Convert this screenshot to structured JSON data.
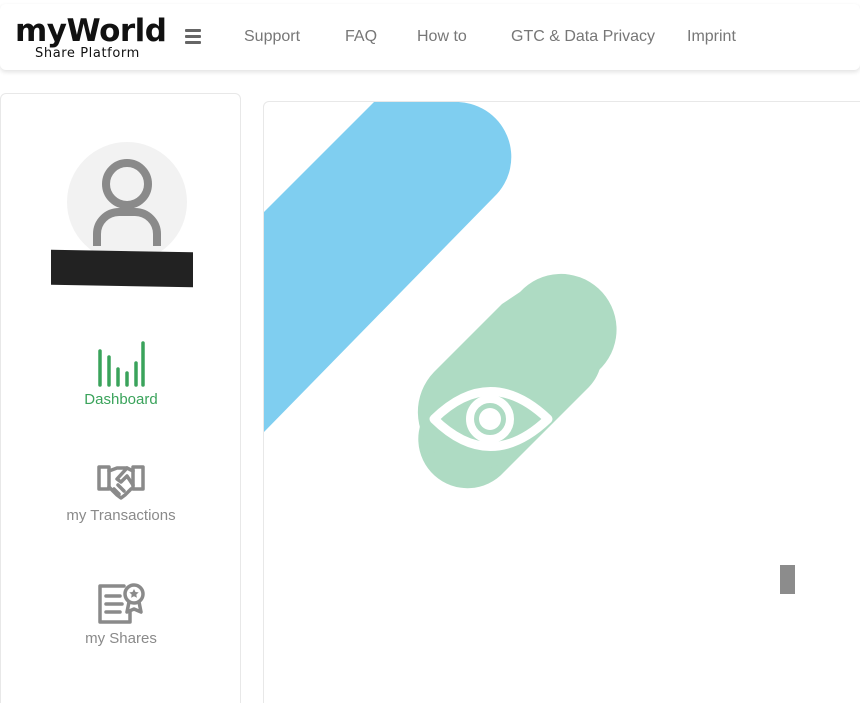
{
  "header": {
    "logo_main": "myWorld",
    "logo_sub": "Share Platform",
    "nav": [
      "Support",
      "FAQ",
      "How to",
      "GTC & Data Privacy",
      "Imprint"
    ]
  },
  "sidebar": {
    "items": [
      {
        "label": "Dashboard",
        "icon": "bar-chart-icon",
        "active": true
      },
      {
        "label": "my Transactions",
        "icon": "handshake-icon",
        "active": false
      },
      {
        "label": "my Shares",
        "icon": "certificate-icon",
        "active": false
      }
    ]
  },
  "colors": {
    "active_green": "#3aa35b",
    "inactive_grey": "#8a8a8a",
    "blue_shape": "#7fcef0",
    "green_shape": "#aedbc3"
  }
}
